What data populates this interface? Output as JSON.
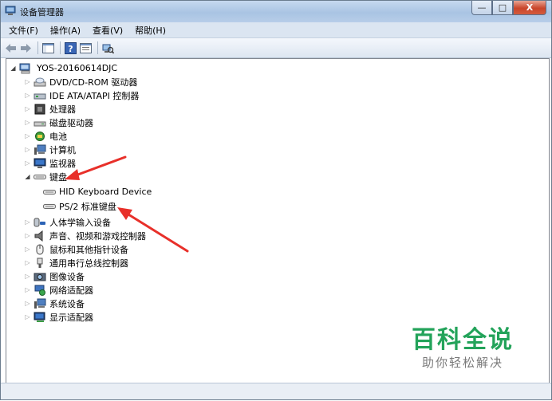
{
  "window": {
    "title": "设备管理器"
  },
  "window_buttons": {
    "minimize": "—",
    "maximize": "□",
    "close": "X"
  },
  "menu": [
    "文件(F)",
    "操作(A)",
    "查看(V)",
    "帮助(H)"
  ],
  "tree": {
    "root": "YOS-20160614DJC",
    "items": [
      {
        "label": "DVD/CD-ROM 驱动器",
        "icon": "dvd-drive-icon"
      },
      {
        "label": "IDE ATA/ATAPI 控制器",
        "icon": "ide-controller-icon"
      },
      {
        "label": "处理器",
        "icon": "processor-icon"
      },
      {
        "label": "磁盘驱动器",
        "icon": "disk-drive-icon"
      },
      {
        "label": "电池",
        "icon": "battery-icon"
      },
      {
        "label": "计算机",
        "icon": "computer-icon"
      },
      {
        "label": "监视器",
        "icon": "monitor-icon"
      },
      {
        "label": "键盘",
        "icon": "keyboard-icon",
        "expanded": true,
        "children": [
          "HID Keyboard Device",
          "PS/2 标准键盘"
        ]
      },
      {
        "label": "人体学输入设备",
        "icon": "hid-icon"
      },
      {
        "label": "声音、视频和游戏控制器",
        "icon": "speaker-icon"
      },
      {
        "label": "鼠标和其他指针设备",
        "icon": "mouse-icon"
      },
      {
        "label": "通用串行总线控制器",
        "icon": "usb-icon"
      },
      {
        "label": "图像设备",
        "icon": "camera-icon"
      },
      {
        "label": "网络适配器",
        "icon": "network-icon"
      },
      {
        "label": "系统设备",
        "icon": "system-devices-icon"
      },
      {
        "label": "显示适配器",
        "icon": "display-adapter-icon"
      }
    ]
  },
  "watermark": {
    "main": "百科全说",
    "sub": "助你轻松解决"
  },
  "colors": {
    "arrow": "#e8302a",
    "watermark_green": "#23a35a",
    "titlebar": "#b7cde8"
  }
}
